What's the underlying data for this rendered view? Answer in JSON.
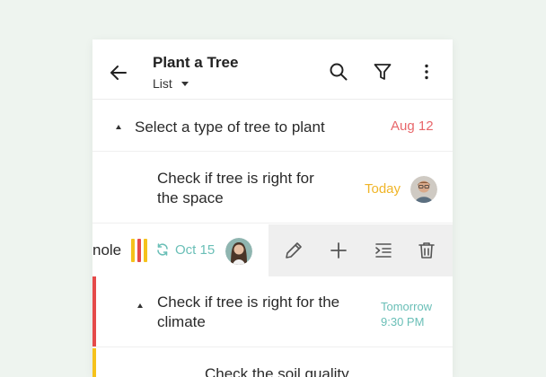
{
  "header": {
    "title": "Plant a Tree",
    "view_label": "List"
  },
  "tasks": [
    {
      "text": "Select a type of tree to plant",
      "date": "Aug 12"
    },
    {
      "text_line1": "Check if tree is right for",
      "text_line2": "the space",
      "date": "Today"
    },
    {
      "text_partial": "nole",
      "date": "Oct 15"
    },
    {
      "text_line1": "Check if tree is right for the",
      "text_line2": "climate",
      "date_line1": "Tomorrow",
      "date_line2": "9:30 PM"
    },
    {
      "text": "Check the soil quality"
    }
  ],
  "colors": {
    "accent_red": "#e8676b",
    "accent_yellow": "#f0b528",
    "accent_teal": "#6abfb7",
    "swipe_bg": "#efefef",
    "priority_red": "#e54a4a",
    "priority_yellow": "#f5c21b"
  },
  "icons": [
    "arrow-left-icon",
    "search-icon",
    "filter-icon",
    "more-vert-icon",
    "pencil-icon",
    "plus-icon",
    "indent-icon",
    "trash-icon",
    "repeat-icon"
  ]
}
